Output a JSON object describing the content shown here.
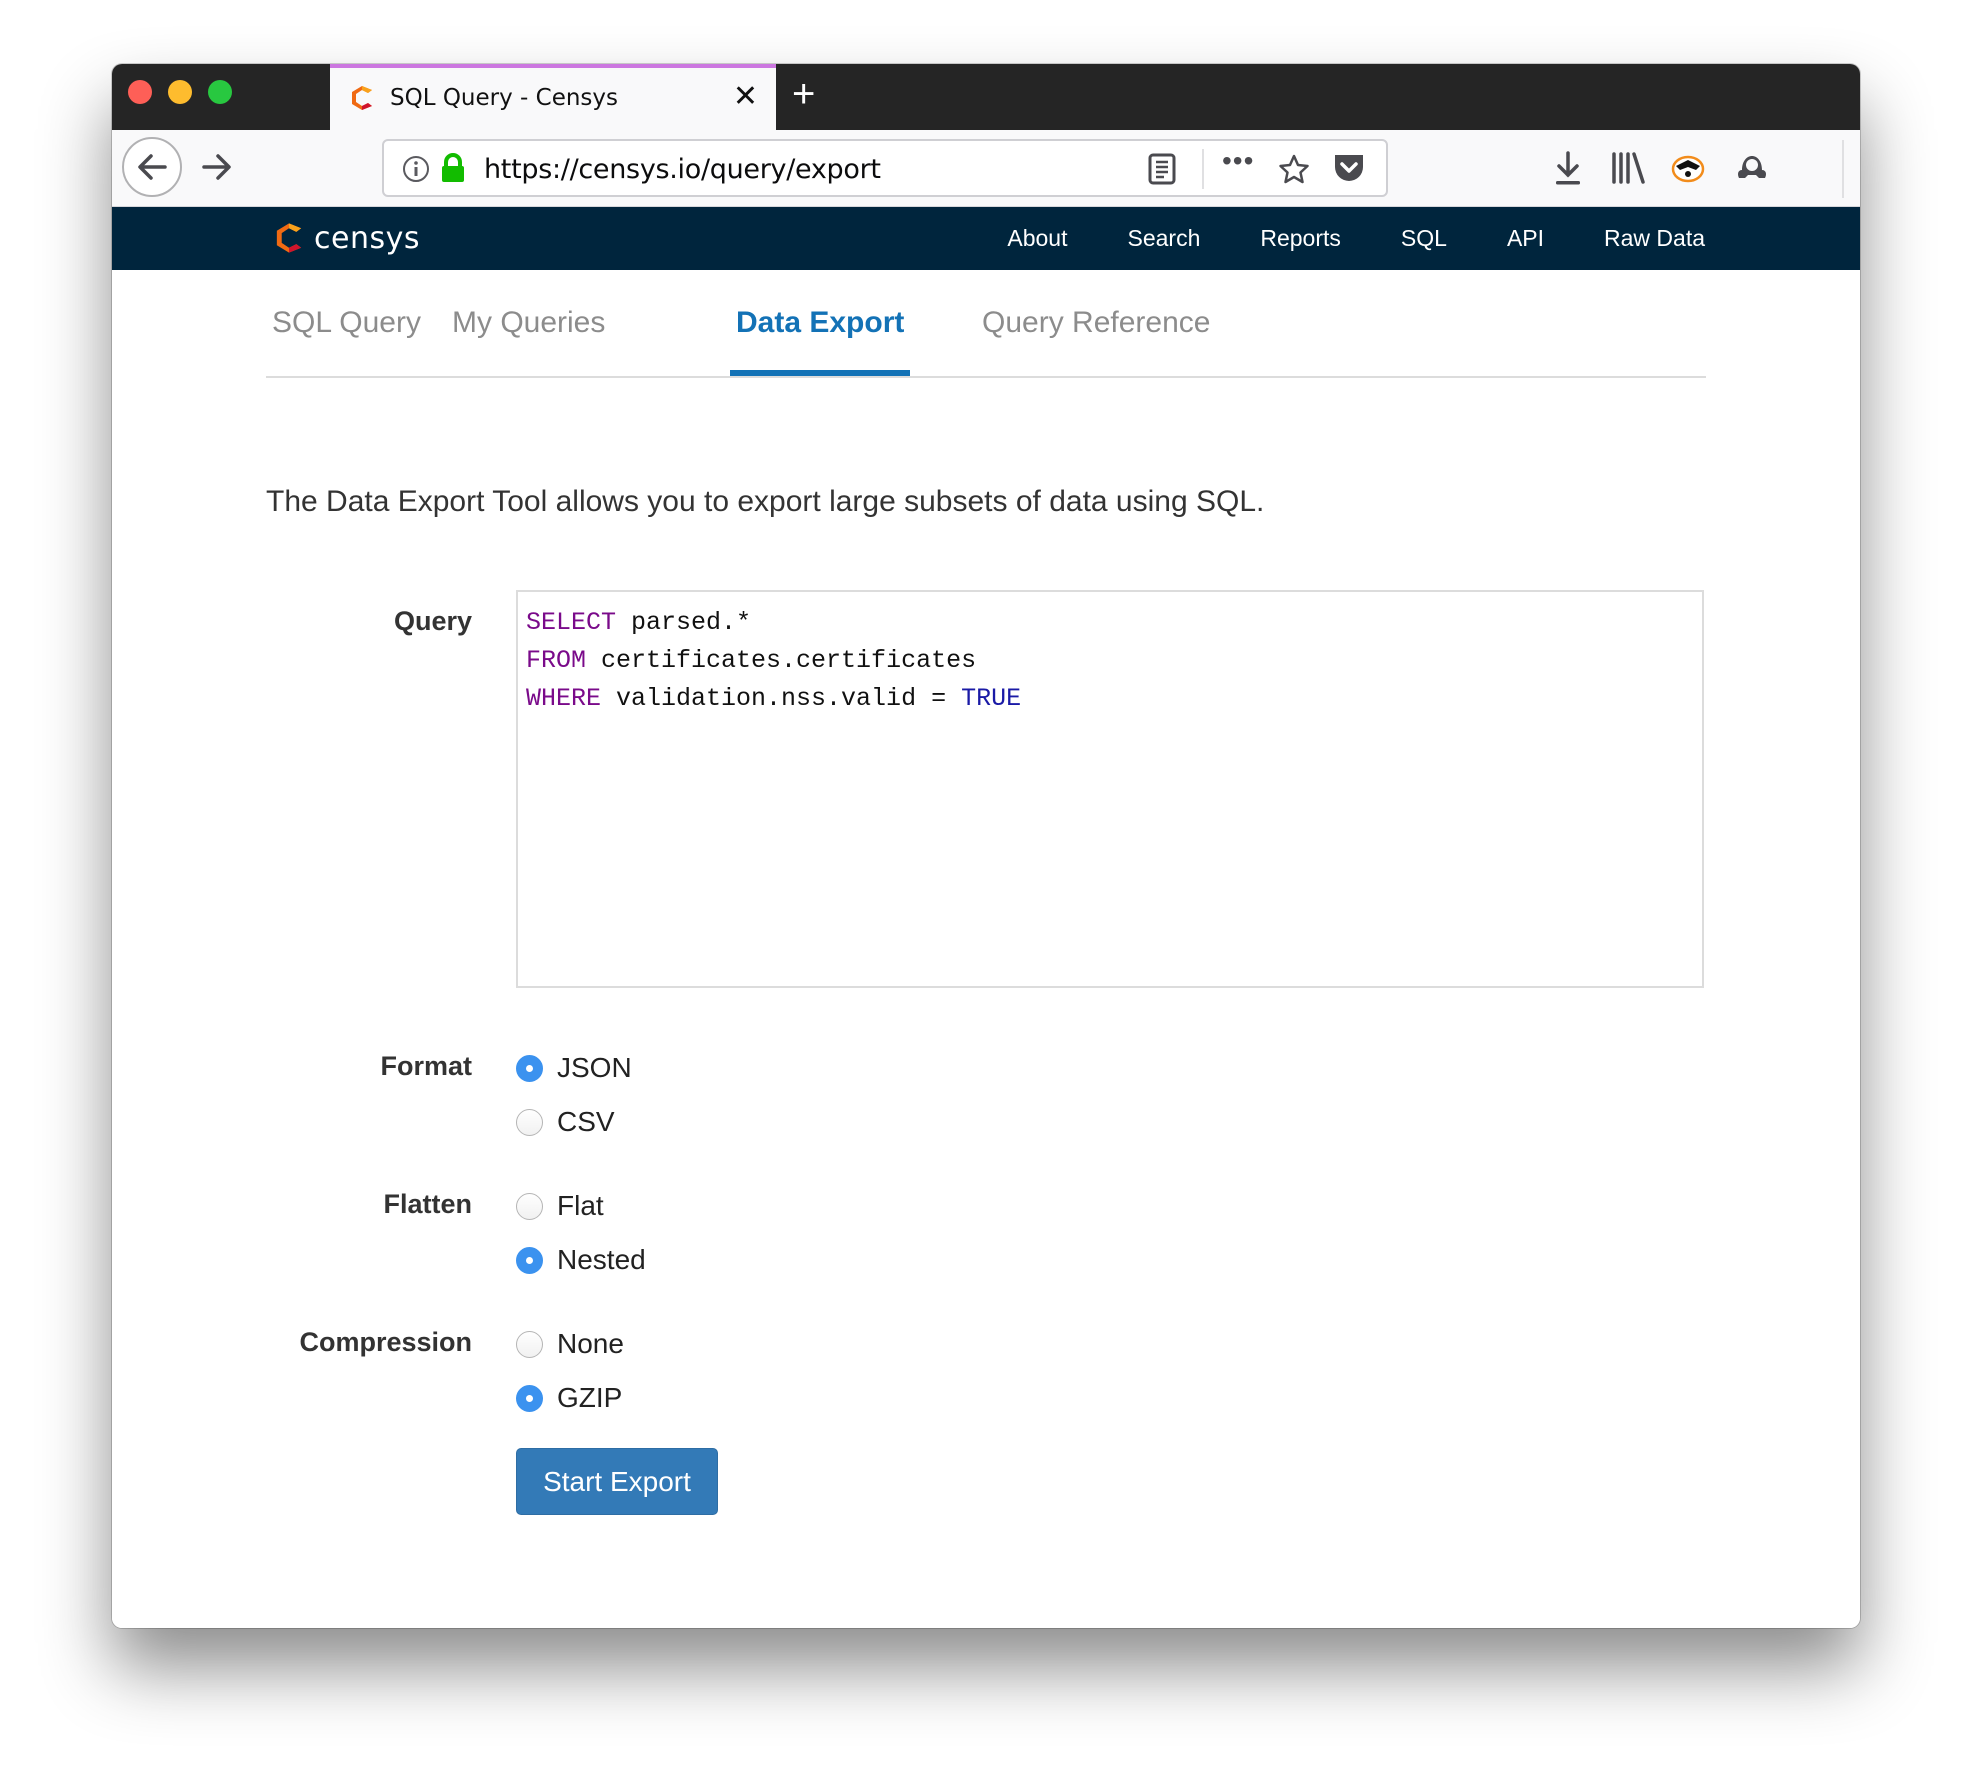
{
  "browser": {
    "tab": {
      "title": "SQL Query - Censys",
      "close_icon": "close-icon"
    },
    "new_tab_icon": "plus-icon",
    "url": "https://censys.io/query/export",
    "toolbar_icons": [
      "back-arrow-icon",
      "forward-arrow-icon",
      "info-icon",
      "lock-icon",
      "reader-view-icon",
      "more-icon",
      "bookmark-star-icon",
      "pocket-icon",
      "download-icon",
      "library-icon",
      "privacy-badger-icon",
      "extension-icon",
      "menu-icon"
    ],
    "accent_color": "#cc77e0"
  },
  "site": {
    "logo_text": "censys",
    "nav": [
      "About",
      "Search",
      "Reports",
      "SQL",
      "API",
      "Raw Data"
    ],
    "nav_bg": "#00253d"
  },
  "subtabs": [
    {
      "label": "SQL Query",
      "active": false
    },
    {
      "label": "My Queries",
      "active": false
    },
    {
      "label": "Data Export",
      "active": true
    },
    {
      "label": "Query Reference",
      "active": false
    }
  ],
  "description": "The Data Export Tool allows you to export large subsets of data using SQL.",
  "form": {
    "query_label": "Query",
    "query_lines": [
      {
        "kw": "SELECT",
        "rest": " parsed.*",
        "bool": ""
      },
      {
        "kw": "FROM",
        "rest": " certificates.certificates",
        "bool": ""
      },
      {
        "kw": "WHERE",
        "rest": " validation.nss.valid = ",
        "bool": "TRUE"
      }
    ],
    "format": {
      "label": "Format",
      "options": [
        "JSON",
        "CSV"
      ],
      "selected": "JSON"
    },
    "flatten": {
      "label": "Flatten",
      "options": [
        "Flat",
        "Nested"
      ],
      "selected": "Nested"
    },
    "compression": {
      "label": "Compression",
      "options": [
        "None",
        "GZIP"
      ],
      "selected": "GZIP"
    },
    "submit_label": "Start Export",
    "button_color": "#337ab7",
    "radio_checked_color": "#3b92ef"
  }
}
